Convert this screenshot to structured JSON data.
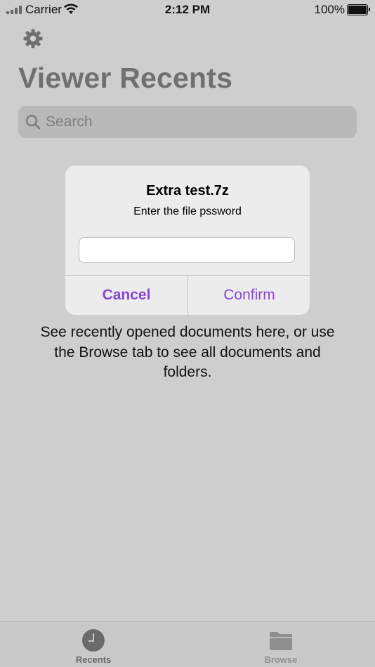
{
  "status_bar": {
    "carrier": "Carrier",
    "time": "2:12 PM",
    "battery": "100%"
  },
  "header": {
    "settings_icon": "gear-icon",
    "title": "Viewer Recents"
  },
  "search": {
    "icon": "search-icon",
    "placeholder": "Search"
  },
  "empty_state": {
    "message": "See recently opened documents here, or use the Browse tab to see all documents and folders."
  },
  "alert": {
    "title": "Extra test.7z",
    "message": "Enter the file pssword",
    "input_value": "",
    "cancel_label": "Cancel",
    "confirm_label": "Confirm"
  },
  "tab_bar": {
    "tabs": [
      {
        "label": "Recents",
        "icon": "clock-icon",
        "selected": true
      },
      {
        "label": "Browse",
        "icon": "folder-icon",
        "selected": false
      }
    ]
  },
  "colors": {
    "accent": "#8a45d6",
    "dimmed_background": "#cecece"
  }
}
